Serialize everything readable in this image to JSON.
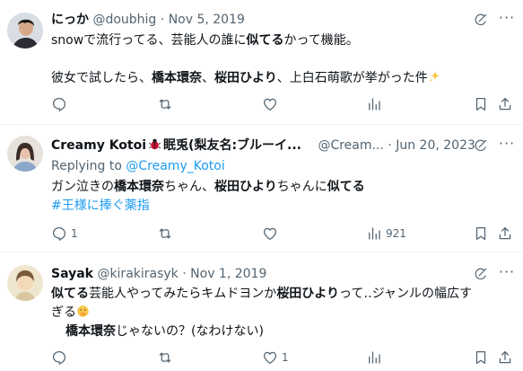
{
  "tweets": [
    {
      "display_name": "にっか",
      "handle": "@doubhig",
      "dot": "·",
      "date": "Nov 5, 2019",
      "line1": "snowで流行ってる、芸能人の誰に",
      "line1_bold": "似てる",
      "line1_tail": "かって機能。",
      "line2_a": "彼女で試したら、",
      "line2_b": "橋本環奈",
      "line2_c": "、",
      "line2_d": "桜田ひより",
      "line2_e": "、上白石萌歌が挙がった件",
      "emoji": "sparkles-emoji"
    },
    {
      "display_name": "Creamy Kotoi",
      "display_name_tail": "眠兎(梨友名:ブルーイ...",
      "handle": "@Cream...",
      "dot": "·",
      "date": "Jun 20, 2023",
      "replying_prefix": "Replying to ",
      "replying_to": "@Creamy_Kotoi",
      "line1_a": "ガン泣きの",
      "line1_b": "橋本環奈",
      "line1_c": "ちゃん、",
      "line1_d": "桜田ひより",
      "line1_e": "ちゃんに",
      "line1_f": "似てる",
      "hashtag": "#王様に捧ぐ薬指",
      "reply_count": "1",
      "views_count": "921"
    },
    {
      "display_name": "Sayak",
      "handle": "@kirakirasyk",
      "dot": "·",
      "date": "Nov 1, 2019",
      "line1_a": "似てる",
      "line1_b": "芸能人やってみたらキムドヨンか",
      "line1_c": "桜田ひより",
      "line1_d": "って‥ジャンルの幅広す",
      "line2": "ぎる",
      "line3_a": "橋本環奈",
      "line3_b": "じゃないの？(なわけない)",
      "reply_count": "1"
    }
  ],
  "icons": [
    "reply-icon",
    "retweet-icon",
    "like-icon",
    "views-icon",
    "bookmark-icon",
    "share-icon",
    "grok-icon",
    "more-icon"
  ],
  "colors": {
    "text": "#0f1419",
    "muted": "#536471",
    "link": "#1d9bf0",
    "separator": "#eff3f4"
  }
}
